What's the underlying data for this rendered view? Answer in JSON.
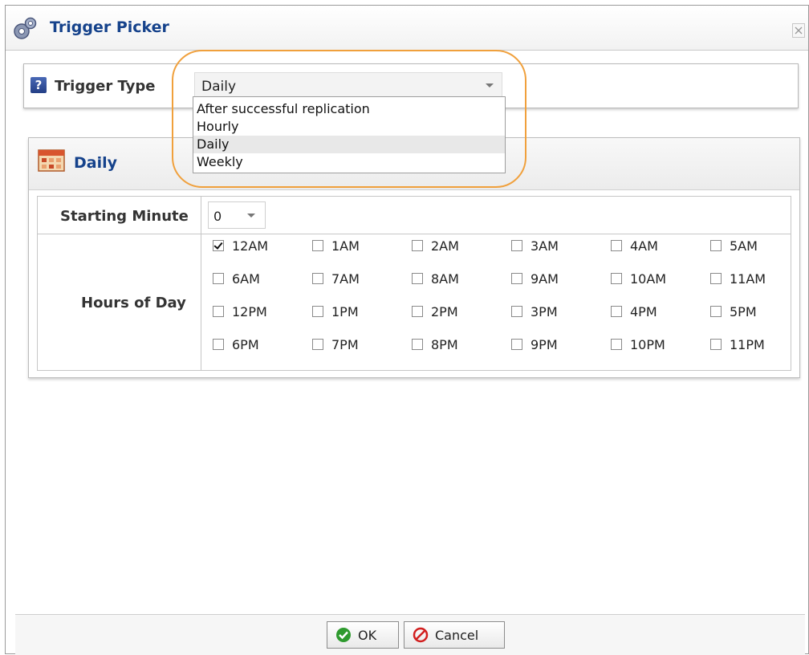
{
  "window": {
    "title": "Trigger Picker"
  },
  "trigger": {
    "label": "Trigger Type",
    "selected": "Daily",
    "options": [
      "After successful replication",
      "Hourly",
      "Daily",
      "Weekly"
    ]
  },
  "daily": {
    "title": "Daily",
    "starting_minute_label": "Starting Minute",
    "starting_minute_value": "0",
    "hours_label": "Hours of Day",
    "hours": [
      {
        "label": "12AM",
        "checked": true
      },
      {
        "label": "1AM",
        "checked": false
      },
      {
        "label": "2AM",
        "checked": false
      },
      {
        "label": "3AM",
        "checked": false
      },
      {
        "label": "4AM",
        "checked": false
      },
      {
        "label": "5AM",
        "checked": false
      },
      {
        "label": "6AM",
        "checked": false
      },
      {
        "label": "7AM",
        "checked": false
      },
      {
        "label": "8AM",
        "checked": false
      },
      {
        "label": "9AM",
        "checked": false
      },
      {
        "label": "10AM",
        "checked": false
      },
      {
        "label": "11AM",
        "checked": false
      },
      {
        "label": "12PM",
        "checked": false
      },
      {
        "label": "1PM",
        "checked": false
      },
      {
        "label": "2PM",
        "checked": false
      },
      {
        "label": "3PM",
        "checked": false
      },
      {
        "label": "4PM",
        "checked": false
      },
      {
        "label": "5PM",
        "checked": false
      },
      {
        "label": "6PM",
        "checked": false
      },
      {
        "label": "7PM",
        "checked": false
      },
      {
        "label": "8PM",
        "checked": false
      },
      {
        "label": "9PM",
        "checked": false
      },
      {
        "label": "10PM",
        "checked": false
      },
      {
        "label": "11PM",
        "checked": false
      }
    ]
  },
  "buttons": {
    "ok": "OK",
    "cancel": "Cancel"
  },
  "colors": {
    "title_blue": "#15428b",
    "highlight_orange": "#f0a03c",
    "ok_green": "#2e9a2e",
    "cancel_red": "#d21f1f"
  }
}
